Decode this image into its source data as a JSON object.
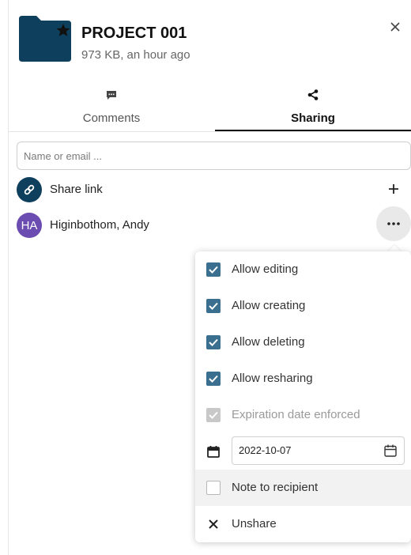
{
  "header": {
    "title": "PROJECT 001",
    "subtitle": "973 KB, an hour ago",
    "folder_color": "#0e3f5c"
  },
  "tabs": [
    {
      "label": "Comments",
      "icon": "comment-icon",
      "active": false
    },
    {
      "label": "Sharing",
      "icon": "share-icon",
      "active": true
    }
  ],
  "search": {
    "placeholder": "Name or email ..."
  },
  "share_link": {
    "label": "Share link",
    "icon": "link-icon"
  },
  "share_user": {
    "initials": "HA",
    "name": "Higinbothom, Andy",
    "avatar_color": "#6b4cb0"
  },
  "menu": {
    "items": [
      {
        "label": "Allow editing",
        "checked": true
      },
      {
        "label": "Allow creating",
        "checked": true
      },
      {
        "label": "Allow deleting",
        "checked": true
      },
      {
        "label": "Allow resharing",
        "checked": true
      },
      {
        "label": "Expiration date enforced",
        "checked": true,
        "disabled": true
      }
    ],
    "expiration_date": "2022-10-07",
    "note": {
      "label": "Note to recipient",
      "checked": false
    },
    "unshare": {
      "label": "Unshare"
    }
  },
  "colors": {
    "checkbox": "#3a6f8f",
    "avatar_link": "#0e3f5c",
    "accent_text": "#111111"
  }
}
